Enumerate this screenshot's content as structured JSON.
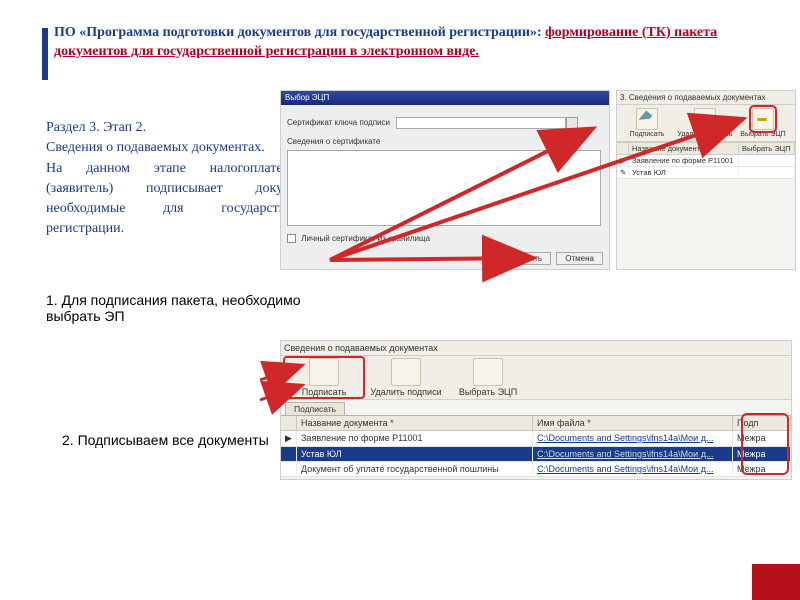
{
  "title": {
    "line1": "ПО «Программа подготовки документов для государственной регистрации»:",
    "line2": "формирование (ТК) пакета документов для государственной регистрации в электронном виде."
  },
  "section_text": {
    "l1": "Раздел 3. Этап 2.",
    "l2": "Сведения о подаваемых документах.",
    "l3": "На данном этапе налогоплательщик (заявитель) подписывает документы необходимые для государственной регистрации."
  },
  "steps": {
    "s1": "1.  Для подписания пакета, необходимо выбрать ЭП",
    "s2": "2. Подписываем все документы"
  },
  "shot1": {
    "window_title": "Выбор ЭЦП",
    "label_cert": "Сертификат ключа подписи",
    "label_certinfo": "Сведения о сертификате",
    "checkbox": "Личный сертификат из хранилища",
    "btn_ok": "Применить",
    "btn_cancel": "Отмена"
  },
  "shot2": {
    "section_title": "3. Сведения о подаваемых документах",
    "tb": {
      "sign": "Подписать",
      "del": "Удалить подпись",
      "pick": "Выбрать ЭЦП"
    },
    "head": {
      "c1": "Название документа",
      "c2": "Выбрать ЭЦП"
    },
    "rows": [
      {
        "c1": "Заявление по форме Р11001",
        "c2": ""
      },
      {
        "c1": "Устав ЮЛ",
        "c2": ""
      }
    ]
  },
  "shot3": {
    "section_title": "Сведения о подаваемых документах",
    "tb": {
      "sign": "Подписать",
      "del": "Удалить подписи",
      "pick": "Выбрать ЭЦП"
    },
    "tab": "Подписать",
    "head": {
      "c1": "Название документа *",
      "c2": "Имя файла *",
      "c3": "Подп"
    },
    "rows": [
      {
        "c1": "Заявление по форме Р11001",
        "c2": "C:\\Documents and Settings\\ifns14a\\Мои д...",
        "c3": "Межра"
      },
      {
        "c1": "Устав ЮЛ",
        "c2": "C:\\Documents and Settings\\ifns14a\\Мои д...",
        "c3": "Межра"
      },
      {
        "c1": "Документ об уплате государственной пошлины",
        "c2": "C:\\Documents and Settings\\ifns14a\\Мои д...",
        "c3": "Межра"
      }
    ]
  },
  "colors": {
    "accent": "#1a3a8a",
    "alert": "#d02828"
  }
}
